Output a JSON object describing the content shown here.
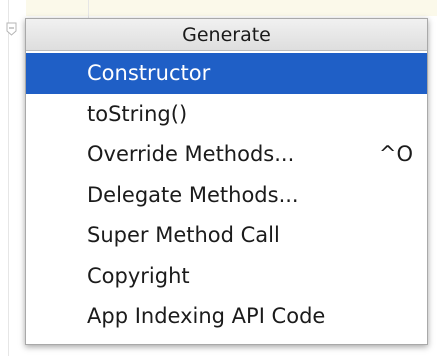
{
  "popup": {
    "title": "Generate",
    "items": [
      {
        "label": "Constructor",
        "shortcut": "",
        "selected": true
      },
      {
        "label": "toString()",
        "shortcut": "",
        "selected": false
      },
      {
        "label": "Override Methods...",
        "shortcut": "^O",
        "selected": false
      },
      {
        "label": "Delegate Methods...",
        "shortcut": "",
        "selected": false
      },
      {
        "label": "Super Method Call",
        "shortcut": "",
        "selected": false
      },
      {
        "label": "Copyright",
        "shortcut": "",
        "selected": false
      },
      {
        "label": "App Indexing API Code",
        "shortcut": "",
        "selected": false
      }
    ]
  },
  "colors": {
    "selection": "#1f5fc6",
    "header_bg": "#e8e8e8",
    "text": "#1b1b1b"
  },
  "icons": {
    "fold_marker": "fold-marker-icon"
  }
}
